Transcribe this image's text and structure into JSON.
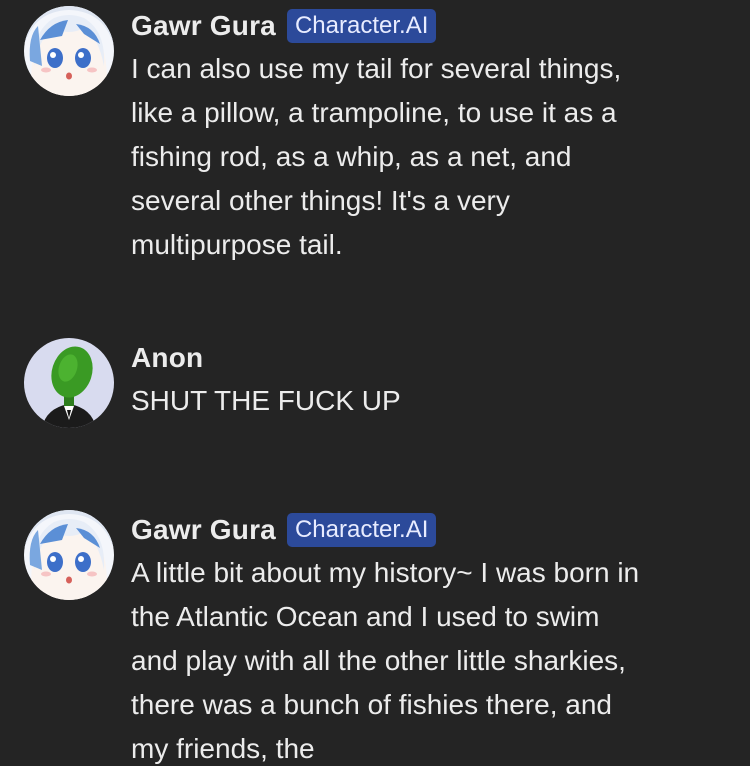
{
  "messages": [
    {
      "author": "Gawr Gura",
      "badge": "Character.AI",
      "avatar": "gura-avatar",
      "text": "I can also use my tail for several things, like a pillow, a trampoline, to use it as a fishing rod, as a whip, as a net, and several other things! It's a very multipurpose tail."
    },
    {
      "author": "Anon",
      "avatar": "anon-green-head-avatar",
      "text": "SHUT THE FUCK UP"
    },
    {
      "author": "Gawr Gura",
      "badge": "Character.AI",
      "avatar": "gura-avatar",
      "text": "A little bit about my history~ I was born in the Atlantic Ocean and I used to swim and play with all the other little sharkies, there was a bunch of fishies there, and my friends, the"
    }
  ],
  "colors": {
    "background": "#242424",
    "text": "#ececec",
    "badge_bg": "#2c4a9a"
  }
}
